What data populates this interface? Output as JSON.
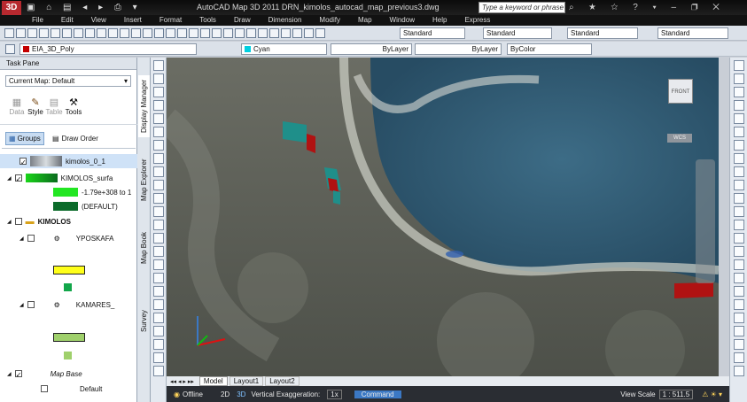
{
  "app": {
    "logo": "3D",
    "title": "AutoCAD Map 3D 2011  DRN_kimolos_autocad_map_previous3.dwg",
    "search_placeholder": "Type a keyword or phrase"
  },
  "menu": [
    "File",
    "Edit",
    "View",
    "Insert",
    "Format",
    "Tools",
    "Draw",
    "Dimension",
    "Modify",
    "Map",
    "Window",
    "Help",
    "Express"
  ],
  "toolbar": {
    "layer": "EIA_3D_Poly",
    "text_style": "Standard",
    "dim_style": "Standard",
    "table_style": "Standard",
    "mleader_style": "Standard",
    "color": "Cyan",
    "linetype": "ByLayer",
    "lineweight": "ByLayer",
    "plotstyle": "ByColor"
  },
  "task_pane": {
    "title": "Task Pane",
    "current_map_label": "Current Map:",
    "current_map": "Default",
    "tools": [
      "Data",
      "Style",
      "Table",
      "Tools"
    ],
    "groups": "Groups",
    "draw_order": "Draw Order",
    "layers": {
      "kimolos": "kimolos_0_1",
      "surface": "KIMOLOS_surfa",
      "range": "-1.79e+308 to 1",
      "default_range": "(DEFAULT)",
      "group": "KIMOLOS",
      "yposkafa": "YPOSKAFA",
      "kamares": "KAMARES_",
      "map_base": "Map Base",
      "default_layer": "Default"
    }
  },
  "side_tabs": [
    "Display Manager",
    "Map Explorer",
    "Map Book",
    "Survey"
  ],
  "viewport": {
    "viewcube_face": "FRONT",
    "wcs": "WCS"
  },
  "layout_tabs": [
    "Model",
    "Layout1",
    "Layout2"
  ],
  "status": {
    "offline": "Offline",
    "mode_2d": "2D",
    "mode_3d": "3D",
    "vert_label": "Vertical Exaggeration:",
    "vert_value": "1x",
    "command": "Command",
    "scale_label": "View Scale",
    "scale_value": "1 : 511.5"
  },
  "colors": {
    "accent": "#3b78c4",
    "teal": "#1f8f8a",
    "red": "#b01212"
  }
}
